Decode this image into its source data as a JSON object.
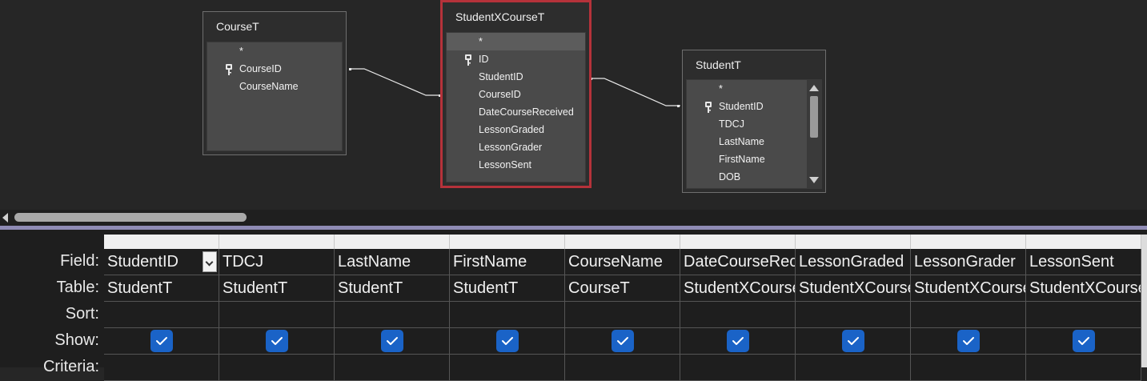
{
  "tables": [
    {
      "title": "CourseT",
      "fields": [
        "*",
        "CourseID",
        "CourseName"
      ],
      "key_index": 1
    },
    {
      "title": "StudentXCourseT",
      "fields": [
        "*",
        "ID",
        "StudentID",
        "CourseID",
        "DateCourseReceived",
        "LessonGraded",
        "LessonGrader",
        "LessonSent"
      ],
      "key_index": 1
    },
    {
      "title": "StudentT",
      "fields": [
        "*",
        "StudentID",
        "TDCJ",
        "LastName",
        "FirstName",
        "DOB"
      ],
      "key_index": 1
    }
  ],
  "grid": {
    "row_labels": [
      "Field:",
      "Table:",
      "Sort:",
      "Show:",
      "Criteria:"
    ],
    "columns": [
      {
        "field": "StudentID",
        "table": "StudentT",
        "show": true
      },
      {
        "field": "TDCJ",
        "table": "StudentT",
        "show": true
      },
      {
        "field": "LastName",
        "table": "StudentT",
        "show": true
      },
      {
        "field": "FirstName",
        "table": "StudentT",
        "show": true
      },
      {
        "field": "CourseName",
        "table": "CourseT",
        "show": true
      },
      {
        "field": "DateCourseReceived",
        "table": "StudentXCourseT",
        "show": true
      },
      {
        "field": "LessonGraded",
        "table": "StudentXCourseT",
        "show": true
      },
      {
        "field": "LessonGrader",
        "table": "StudentXCourseT",
        "show": true
      },
      {
        "field": "LessonSent",
        "table": "StudentXCourseT",
        "show": true
      }
    ]
  },
  "colors": {
    "checkbox": "#1a63c7",
    "selected_table_border": "#b5323a",
    "divider": "#8f8bb5"
  },
  "icons": {
    "key": "key-icon",
    "check": "checkmark-icon",
    "dropdown": "chevron-down-icon"
  }
}
